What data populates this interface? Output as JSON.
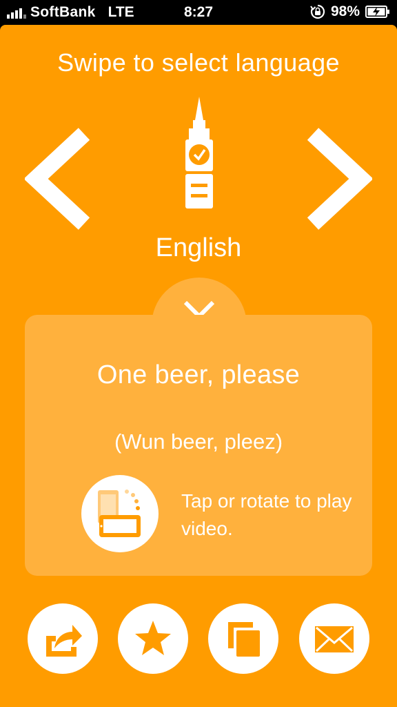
{
  "status_bar": {
    "carrier": "SoftBank",
    "network": "LTE",
    "time": "8:27",
    "battery": "98%"
  },
  "header": {
    "instruction": "Swipe to select language"
  },
  "language": {
    "name": "English",
    "icon": "big-ben-icon"
  },
  "card": {
    "phrase": "One beer, please",
    "pronunciation": "(Wun beer, pleez)",
    "video_hint": "Tap or rotate to play video."
  },
  "toolbar": {
    "share_icon": "share-icon",
    "favorite_icon": "star-icon",
    "copy_icon": "copy-icon",
    "email_icon": "envelope-icon"
  },
  "colors": {
    "background": "#ff9c00",
    "card": "#ffb13d",
    "icon": "#ff9c00",
    "text": "#ffffff"
  }
}
